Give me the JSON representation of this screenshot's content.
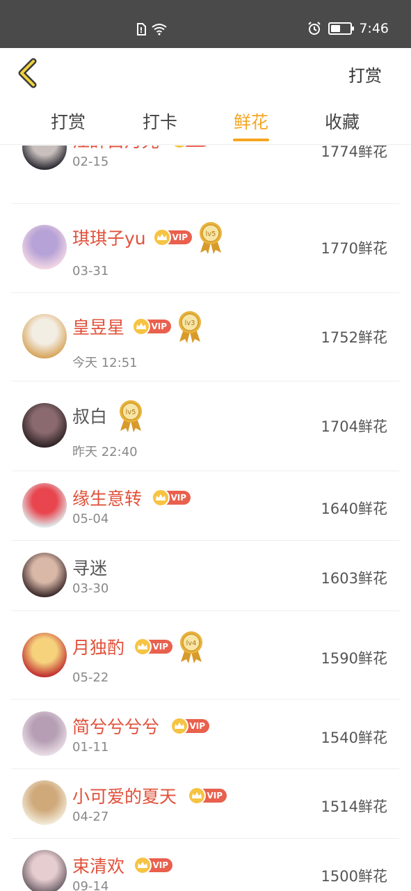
{
  "status_bar": {
    "time": "7:46",
    "battery_level": 0.45
  },
  "app_bar": {
    "action_label": "打赏"
  },
  "tabs": [
    {
      "label": "打赏",
      "active": false
    },
    {
      "label": "打卡",
      "active": false
    },
    {
      "label": "鲜花",
      "active": true
    },
    {
      "label": "收藏",
      "active": false
    }
  ],
  "list": [
    {
      "name": "江辞白月光",
      "date": "02-15",
      "flowers": "1774鲜花",
      "vip": true,
      "level": null
    },
    {
      "name": "琪琪子yu",
      "date": "03-31",
      "flowers": "1770鲜花",
      "vip": true,
      "level": "lv5"
    },
    {
      "name": "皇昱星",
      "date": "今天 12:51",
      "flowers": "1752鲜花",
      "vip": true,
      "level": "lv3"
    },
    {
      "name": "叔白",
      "date": "昨天 22:40",
      "flowers": "1704鲜花",
      "vip": false,
      "level": "lv5"
    },
    {
      "name": "缘生意转",
      "date": "05-04",
      "flowers": "1640鲜花",
      "vip": true,
      "level": null
    },
    {
      "name": "寻迷",
      "date": "03-30",
      "flowers": "1603鲜花",
      "vip": false,
      "level": null
    },
    {
      "name": "月独酌",
      "date": "05-22",
      "flowers": "1590鲜花",
      "vip": true,
      "level": "lv4"
    },
    {
      "name": "简兮兮兮兮",
      "date": "01-11",
      "flowers": "1540鲜花",
      "vip": true,
      "level": null
    },
    {
      "name": "小可爱的夏天",
      "date": "04-27",
      "flowers": "1514鲜花",
      "vip": true,
      "level": null
    },
    {
      "name": "束清欢",
      "date": "09-14",
      "flowers": "1500鲜花",
      "vip": true,
      "level": null
    }
  ],
  "badge_text": {
    "vip": "VIP"
  },
  "colors": {
    "accent": "#f5a623",
    "vip_name": "#e0513a",
    "vip_badge": "#e9604d",
    "status_bar": "#4a4a4a"
  }
}
